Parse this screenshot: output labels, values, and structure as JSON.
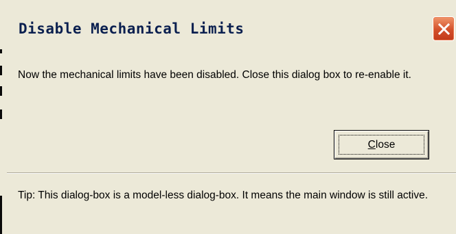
{
  "window": {
    "title": "Disable Mechanical Limits"
  },
  "message": {
    "text": "Now the mechanical limits have been disabled. Close this dialog box to re-enable it."
  },
  "buttons": {
    "close_label_mnemonic": "C",
    "close_label_rest": "lose"
  },
  "tip": {
    "text": "Tip: This dialog-box is a model-less dialog-box. It means the main window is still active."
  },
  "icons": {
    "title_close": "close-icon"
  },
  "colors": {
    "dialog_background": "#ece9d8",
    "title_text": "#0a1f4f",
    "close_button_red": "#d2502a"
  }
}
